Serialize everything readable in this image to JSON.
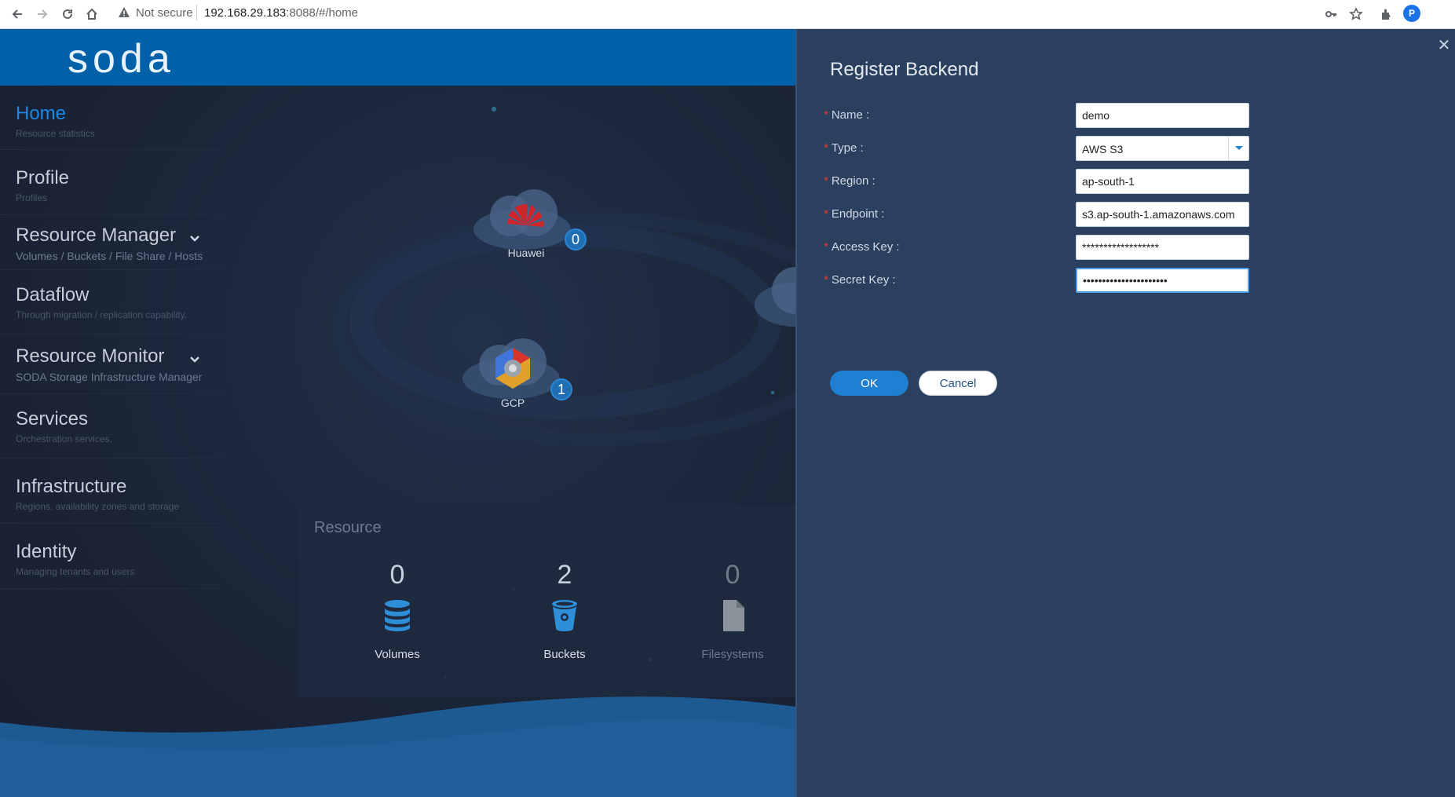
{
  "browser": {
    "security_label": "Not secure",
    "url_host": "192.168.29.183",
    "url_rest": ":8088/#/home",
    "profile_initial": "P"
  },
  "app": {
    "logo_text": "soda"
  },
  "sidebar": {
    "items": [
      {
        "title": "Home",
        "subtitle": "Resource statistics",
        "active": true
      },
      {
        "title": "Profile",
        "subtitle": "Profiles"
      },
      {
        "title": "Resource Manager",
        "subtitle": "Volumes / Buckets / File Share / Hosts",
        "expandable": true
      },
      {
        "title": "Dataflow",
        "subtitle": "Through migration / replication capability."
      },
      {
        "title": "Resource Monitor",
        "subtitle": "SODA Storage Infrastructure Manager",
        "expandable": true
      },
      {
        "title": "Services",
        "subtitle": "Orchestration services."
      },
      {
        "title": "Infrastructure",
        "subtitle": "Regions, availability zones and storage"
      },
      {
        "title": "Identity",
        "subtitle": "Managing tenants and users"
      }
    ]
  },
  "clouds": {
    "huawei": {
      "label": "Huawei",
      "count": "0"
    },
    "gcp": {
      "label": "GCP",
      "count": "1"
    }
  },
  "resource": {
    "title": "Resource",
    "volumes": {
      "count": "0",
      "label": "Volumes"
    },
    "buckets": {
      "count": "2",
      "label": "Buckets"
    },
    "filesystems": {
      "count": "0",
      "label": "Filesystems"
    }
  },
  "dialog": {
    "title": "Register Backend",
    "fields": {
      "name": {
        "label": "Name :",
        "value": "demo"
      },
      "type": {
        "label": "Type :",
        "value": "AWS S3"
      },
      "region": {
        "label": "Region :",
        "value": "ap-south-1"
      },
      "endpoint": {
        "label": "Endpoint :",
        "value": "s3.ap-south-1.amazonaws.com"
      },
      "access_key": {
        "label": "Access Key :",
        "value": "******************"
      },
      "secret_key": {
        "label": "Secret Key :",
        "value": "••••••••••••••••••••••"
      }
    },
    "ok_label": "OK",
    "cancel_label": "Cancel"
  },
  "colors": {
    "header_blue": "#0060a8",
    "dialog_bg": "#2b3f5e",
    "active_nav": "#1e88e5",
    "required_star": "#e53935",
    "ok_button": "#1f7fd0"
  }
}
